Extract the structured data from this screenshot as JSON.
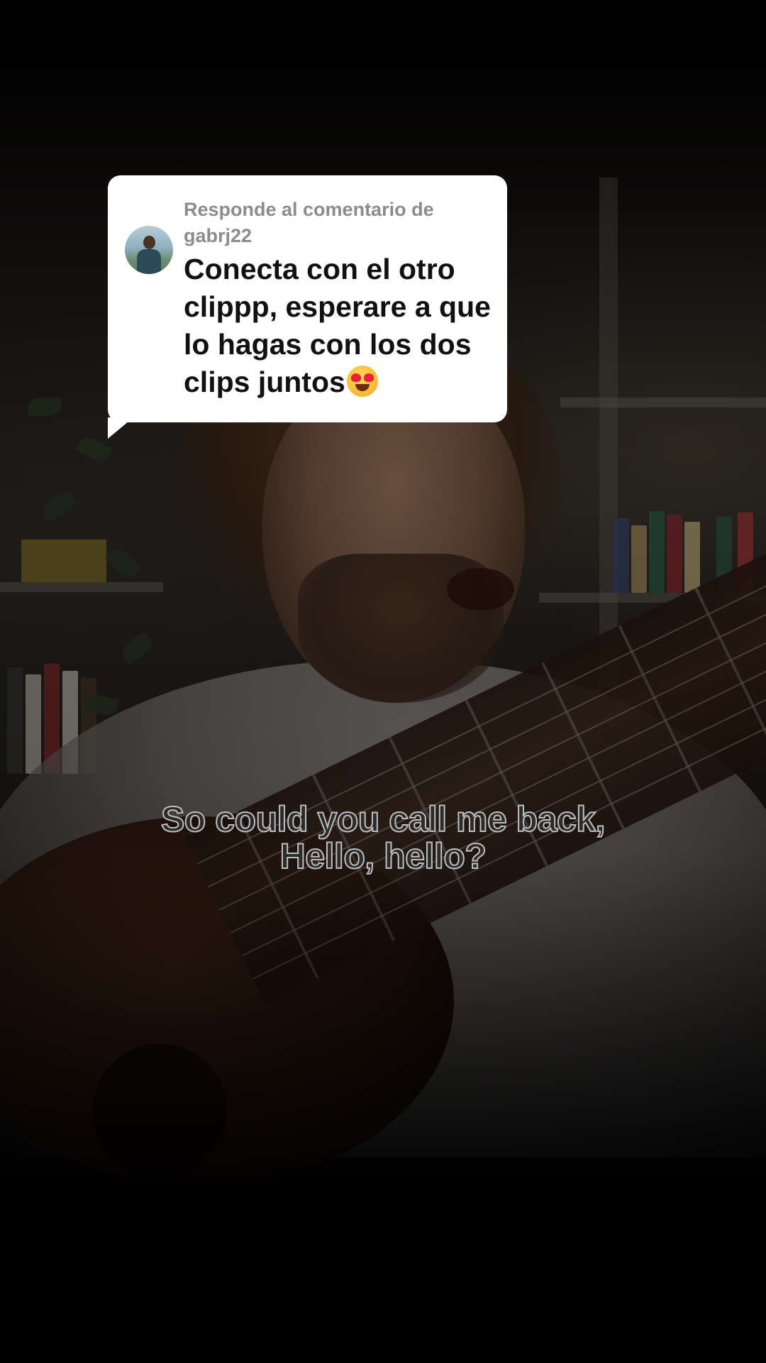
{
  "reply_sticker": {
    "header_line1": "Responde al comentario de",
    "username": "gabrj22",
    "comment_text": "Conecta con el otro clippp, esperare a que lo hagas con los dos clips juntos",
    "comment_emoji": "smiling-face-with-heart-eyes"
  },
  "caption": {
    "line1": "So could you call me back,",
    "line2": "Hello, hello?"
  },
  "colors": {
    "sticker_background": "#ffffff",
    "header_text": "#8c8c8c",
    "comment_text": "#111111",
    "caption_fill": "#2b2b2b",
    "caption_outline": "#bfbfbf"
  }
}
